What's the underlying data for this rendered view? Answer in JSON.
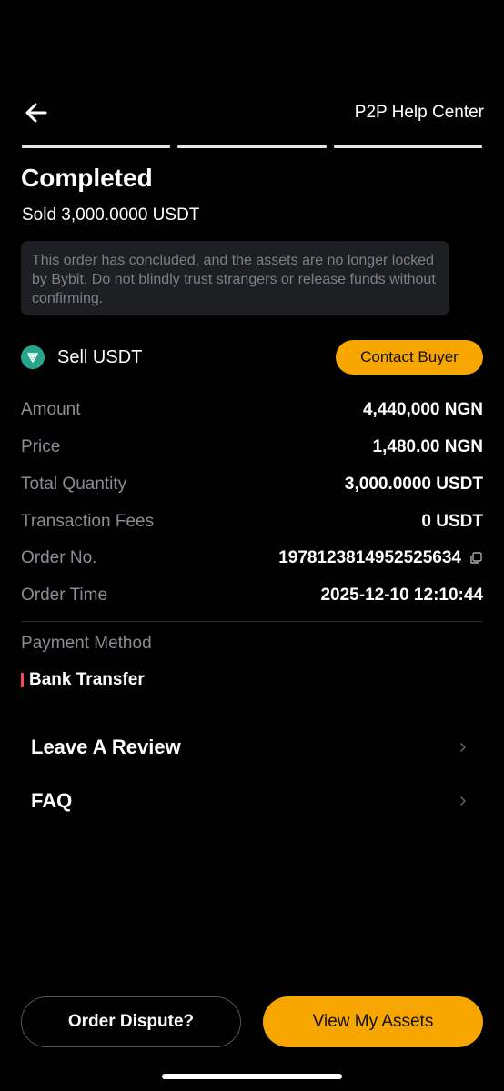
{
  "header": {
    "help_label": "P2P Help Center"
  },
  "status": {
    "title": "Completed",
    "subtitle": "Sold 3,000.0000 USDT",
    "notice": "This order has concluded, and the assets are no longer locked by Bybit. Do not blindly trust strangers or release funds without confirming."
  },
  "trade": {
    "side_label": "Sell USDT",
    "contact_label": "Contact Buyer"
  },
  "details": [
    {
      "label": "Amount",
      "value": "4,440,000 NGN"
    },
    {
      "label": "Price",
      "value": "1,480.00 NGN"
    },
    {
      "label": "Total Quantity",
      "value": "3,000.0000 USDT"
    },
    {
      "label": "Transaction Fees",
      "value": "0 USDT"
    },
    {
      "label": "Order No.",
      "value": "1978123814952525634"
    },
    {
      "label": "Order Time",
      "value": "2025-12-10 12:10:44"
    }
  ],
  "payment": {
    "label": "Payment Method",
    "value": "Bank Transfer"
  },
  "menu": [
    {
      "label": "Leave A Review"
    },
    {
      "label": "FAQ"
    }
  ],
  "footer": {
    "dispute_label": "Order Dispute?",
    "assets_label": "View My Assets"
  },
  "colors": {
    "accent": "#f7a600",
    "tether": "#27a68c",
    "payment_marker": "#f6465d"
  }
}
